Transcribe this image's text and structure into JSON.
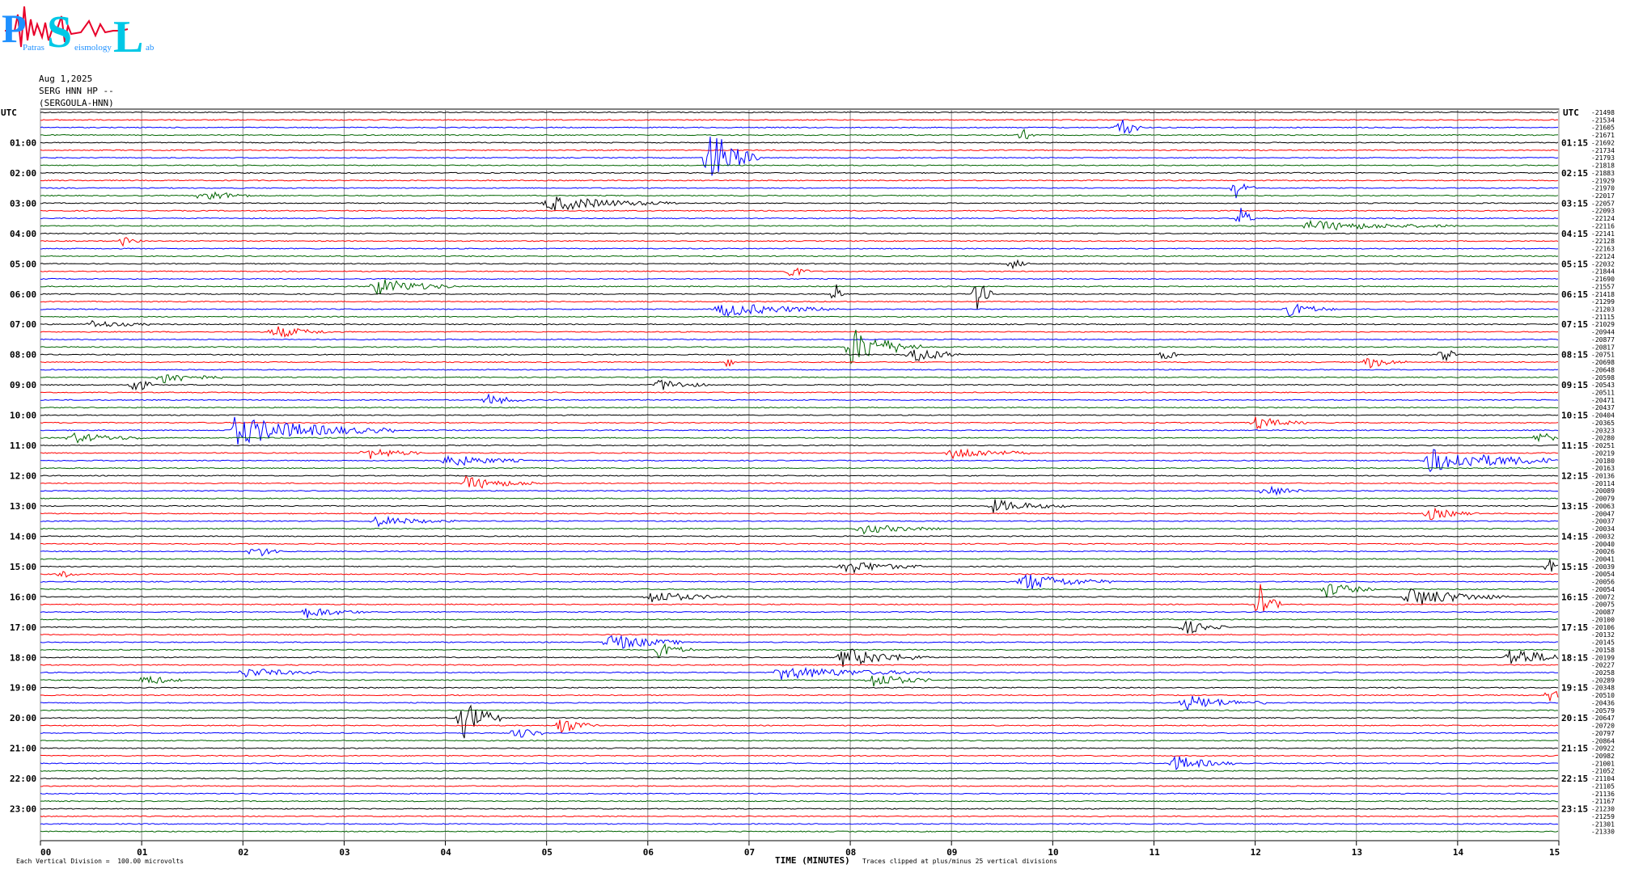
{
  "logo": {
    "letters": [
      "P",
      "S",
      "L"
    ],
    "small_text": [
      "Patras",
      "eismology",
      "ab"
    ],
    "colors": {
      "blue": "#1e90ff",
      "cyan": "#00c8e6",
      "red": "#e8002a"
    }
  },
  "header": {
    "date": "Aug 1,2025",
    "station": "SERG HNN HP --",
    "site": "(SERGOULA-HNN)"
  },
  "footer": {
    "scale": "Each Vertical Division =  100.00 microvolts",
    "xlabel": "TIME (MINUTES)",
    "clip_note": "Traces clipped at plus/minus 25 vertical divisions"
  },
  "chart_data": {
    "type": "line",
    "subtype": "helicorder",
    "xlabel": "TIME (MINUTES)",
    "xlim": [
      0,
      15
    ],
    "x_ticks": [
      "00",
      "01",
      "02",
      "03",
      "04",
      "05",
      "06",
      "07",
      "08",
      "09",
      "10",
      "11",
      "12",
      "13",
      "14",
      "15"
    ],
    "left_axis_title": "UTC",
    "right_axis_title": "UTC",
    "left_labels": [
      "01:00",
      "02:00",
      "03:00",
      "04:00",
      "05:00",
      "06:00",
      "07:00",
      "08:00",
      "09:00",
      "10:00",
      "11:00",
      "12:00",
      "13:00",
      "14:00",
      "15:00",
      "16:00",
      "17:00",
      "18:00",
      "19:00",
      "20:00",
      "21:00",
      "22:00",
      "23:00"
    ],
    "right_labels": [
      "01:15",
      "02:15",
      "03:15",
      "04:15",
      "05:15",
      "06:15",
      "07:15",
      "08:15",
      "09:15",
      "10:15",
      "11:15",
      "12:15",
      "13:15",
      "14:15",
      "15:15",
      "16:15",
      "17:15",
      "18:15",
      "19:15",
      "20:15",
      "21:15",
      "22:15",
      "23:15"
    ],
    "trace_colors": [
      "#000000",
      "#ff0000",
      "#0000ff",
      "#006400"
    ],
    "grid": true,
    "minutes_per_line": 15,
    "line_counts": [
      -21498,
      -21534,
      -21605,
      -21671,
      -21692,
      -21734,
      -21793,
      -21818,
      -21883,
      -21929,
      -21970,
      -22017,
      -22057,
      -22093,
      -22124,
      -22116,
      -22141,
      -22128,
      -22163,
      -22124,
      -22032,
      -21844,
      -21690,
      -21557,
      -21418,
      -21299,
      -21203,
      -21115,
      -21029,
      -20944,
      -20877,
      -20817,
      -20751,
      -20698,
      -20648,
      -20598,
      -20543,
      -20511,
      -20471,
      -20437,
      -20404,
      -20365,
      -20323,
      -20280,
      -20251,
      -20219,
      -20180,
      -20163,
      -20136,
      -20114,
      -20089,
      -20079,
      -20063,
      -20047,
      -20037,
      -20034,
      -20032,
      -20040,
      -20026,
      -20041,
      -20039,
      -20054,
      -20056,
      -20054,
      -20072,
      -20075,
      -20087,
      -20100,
      -20106,
      -20132,
      -20145,
      -20158,
      -20199,
      -20227,
      -20258,
      -20289,
      -20348,
      -20510,
      -20436,
      -20579,
      -20647,
      -20720,
      -20797,
      -20864,
      -20922,
      -20982,
      -21001,
      -21052,
      -21104,
      -21105,
      -21136,
      -21167,
      -21230,
      -21259,
      -21301,
      -21330
    ],
    "events": [
      {
        "line": 2,
        "minute": 10.65,
        "amp": 1.0,
        "dur": 0.25
      },
      {
        "line": 3,
        "minute": 9.7,
        "amp": 0.6,
        "dur": 0.12
      },
      {
        "line": 6,
        "minute": 6.6,
        "amp": 2.4,
        "dur": 0.5
      },
      {
        "line": 10,
        "minute": 11.8,
        "amp": 0.8,
        "dur": 0.2
      },
      {
        "line": 11,
        "minute": 1.6,
        "amp": 0.5,
        "dur": 0.5
      },
      {
        "line": 12,
        "minute": 5.0,
        "amp": 0.6,
        "dur": 1.3
      },
      {
        "line": 14,
        "minute": 11.85,
        "amp": 1.0,
        "dur": 0.15
      },
      {
        "line": 15,
        "minute": 12.5,
        "amp": 0.4,
        "dur": 1.5
      },
      {
        "line": 17,
        "minute": 0.8,
        "amp": 0.4,
        "dur": 0.2
      },
      {
        "line": 20,
        "minute": 9.6,
        "amp": 0.4,
        "dur": 0.2
      },
      {
        "line": 21,
        "minute": 7.4,
        "amp": 0.6,
        "dur": 0.2
      },
      {
        "line": 23,
        "minute": 3.3,
        "amp": 0.7,
        "dur": 0.8
      },
      {
        "line": 24,
        "minute": 7.85,
        "amp": 1.0,
        "dur": 0.1
      },
      {
        "line": 24,
        "minute": 9.25,
        "amp": 1.5,
        "dur": 0.15
      },
      {
        "line": 26,
        "minute": 6.7,
        "amp": 0.6,
        "dur": 1.2
      },
      {
        "line": 26,
        "minute": 12.3,
        "amp": 0.6,
        "dur": 0.5
      },
      {
        "line": 28,
        "minute": 0.5,
        "amp": 0.3,
        "dur": 0.6
      },
      {
        "line": 29,
        "minute": 2.3,
        "amp": 0.5,
        "dur": 0.6
      },
      {
        "line": 31,
        "minute": 8.0,
        "amp": 1.5,
        "dur": 0.7
      },
      {
        "line": 32,
        "minute": 8.6,
        "amp": 0.8,
        "dur": 0.5
      },
      {
        "line": 32,
        "minute": 11.1,
        "amp": 0.8,
        "dur": 0.15
      },
      {
        "line": 32,
        "minute": 13.85,
        "amp": 0.9,
        "dur": 0.15
      },
      {
        "line": 33,
        "minute": 6.8,
        "amp": 0.9,
        "dur": 0.05
      },
      {
        "line": 33,
        "minute": 13.1,
        "amp": 0.5,
        "dur": 0.4
      },
      {
        "line": 35,
        "minute": 1.2,
        "amp": 0.5,
        "dur": 0.6
      },
      {
        "line": 36,
        "minute": 0.9,
        "amp": 1.0,
        "dur": 0.2
      },
      {
        "line": 36,
        "minute": 6.1,
        "amp": 0.5,
        "dur": 0.5
      },
      {
        "line": 38,
        "minute": 4.4,
        "amp": 0.5,
        "dur": 0.4
      },
      {
        "line": 41,
        "minute": 12.0,
        "amp": 0.5,
        "dur": 0.5
      },
      {
        "line": 42,
        "minute": 1.9,
        "amp": 1.1,
        "dur": 1.6
      },
      {
        "line": 43,
        "minute": 0.3,
        "amp": 0.4,
        "dur": 0.8
      },
      {
        "line": 43,
        "minute": 14.8,
        "amp": 0.6,
        "dur": 0.3
      },
      {
        "line": 45,
        "minute": 3.2,
        "amp": 0.5,
        "dur": 0.6
      },
      {
        "line": 45,
        "minute": 9.0,
        "amp": 0.5,
        "dur": 0.8
      },
      {
        "line": 46,
        "minute": 4.0,
        "amp": 0.5,
        "dur": 0.8
      },
      {
        "line": 46,
        "minute": 13.7,
        "amp": 0.9,
        "dur": 1.5
      },
      {
        "line": 49,
        "minute": 4.2,
        "amp": 0.5,
        "dur": 0.8
      },
      {
        "line": 50,
        "minute": 12.1,
        "amp": 0.5,
        "dur": 0.4
      },
      {
        "line": 52,
        "minute": 9.4,
        "amp": 0.5,
        "dur": 0.8
      },
      {
        "line": 53,
        "minute": 13.7,
        "amp": 0.5,
        "dur": 0.5
      },
      {
        "line": 54,
        "minute": 3.3,
        "amp": 0.4,
        "dur": 0.8
      },
      {
        "line": 55,
        "minute": 8.1,
        "amp": 0.4,
        "dur": 0.8
      },
      {
        "line": 58,
        "minute": 2.1,
        "amp": 0.6,
        "dur": 0.3
      },
      {
        "line": 60,
        "minute": 7.9,
        "amp": 0.6,
        "dur": 0.8
      },
      {
        "line": 60,
        "minute": 14.9,
        "amp": 0.6,
        "dur": 0.2
      },
      {
        "line": 61,
        "minute": 0.2,
        "amp": 0.4,
        "dur": 0.2
      },
      {
        "line": 62,
        "minute": 9.7,
        "amp": 0.7,
        "dur": 0.9
      },
      {
        "line": 63,
        "minute": 12.7,
        "amp": 0.6,
        "dur": 0.5
      },
      {
        "line": 64,
        "minute": 6.0,
        "amp": 0.5,
        "dur": 0.8
      },
      {
        "line": 64,
        "minute": 13.5,
        "amp": 0.8,
        "dur": 1.0
      },
      {
        "line": 65,
        "minute": 12.05,
        "amp": 1.5,
        "dur": 0.2
      },
      {
        "line": 66,
        "minute": 2.6,
        "amp": 0.5,
        "dur": 0.6
      },
      {
        "line": 68,
        "minute": 11.3,
        "amp": 0.6,
        "dur": 0.4
      },
      {
        "line": 70,
        "minute": 5.6,
        "amp": 0.7,
        "dur": 0.8
      },
      {
        "line": 71,
        "minute": 6.1,
        "amp": 0.6,
        "dur": 0.4
      },
      {
        "line": 72,
        "minute": 7.9,
        "amp": 0.8,
        "dur": 0.9
      },
      {
        "line": 72,
        "minute": 14.5,
        "amp": 0.8,
        "dur": 0.7
      },
      {
        "line": 74,
        "minute": 2.0,
        "amp": 0.4,
        "dur": 0.8
      },
      {
        "line": 74,
        "minute": 7.3,
        "amp": 0.5,
        "dur": 1.5
      },
      {
        "line": 75,
        "minute": 1.0,
        "amp": 0.5,
        "dur": 0.4
      },
      {
        "line": 75,
        "minute": 8.2,
        "amp": 0.6,
        "dur": 0.6
      },
      {
        "line": 77,
        "minute": 14.9,
        "amp": 0.6,
        "dur": 0.2
      },
      {
        "line": 78,
        "minute": 11.3,
        "amp": 0.6,
        "dur": 0.8
      },
      {
        "line": 80,
        "minute": 4.15,
        "amp": 1.8,
        "dur": 0.4
      },
      {
        "line": 81,
        "minute": 5.1,
        "amp": 0.8,
        "dur": 0.4
      },
      {
        "line": 82,
        "minute": 4.7,
        "amp": 0.6,
        "dur": 0.3
      },
      {
        "line": 86,
        "minute": 11.2,
        "amp": 0.6,
        "dur": 0.6
      }
    ]
  }
}
